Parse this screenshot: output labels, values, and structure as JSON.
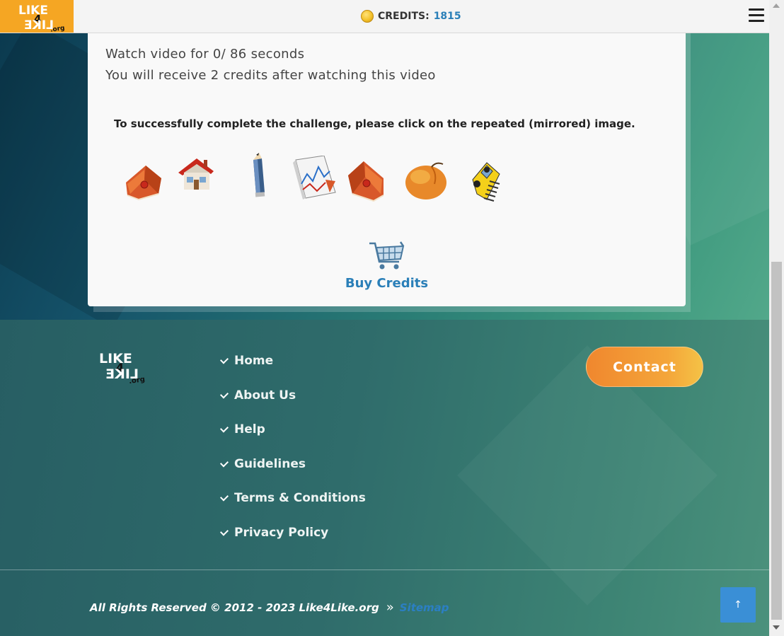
{
  "header": {
    "logo_text_top": "LIKE",
    "logo_text_num": "4",
    "logo_text_bottom": "LIKE",
    "logo_text_suffix": ".org",
    "credits_label": "CREDITS:",
    "credits_value": "1815",
    "coin_icon": "coin-icon",
    "menu_icon": "hamburger-menu-icon"
  },
  "card": {
    "watch_line": "Watch video for 0/ 86 seconds",
    "receive_line": "You will receive 2 credits after watching this video",
    "challenge_text": "To successfully complete the challenge, please click on the repeated (mirrored) image.",
    "captcha_images": [
      {
        "name": "book-icon"
      },
      {
        "name": "house-icon"
      },
      {
        "name": "pencil-icon"
      },
      {
        "name": "chart-icon"
      },
      {
        "name": "book-mirrored-icon"
      },
      {
        "name": "peach-icon"
      },
      {
        "name": "taxi-icon"
      }
    ],
    "buy_icon": "shopping-cart-icon",
    "buy_label": "Buy Credits"
  },
  "footer": {
    "nav": [
      "Home",
      "About Us",
      "Help",
      "Guidelines",
      "Terms & Conditions",
      "Privacy Policy"
    ],
    "contact_label": "Contact",
    "copyright": "All Rights Reserved © 2012 - 2023 Like4Like.org",
    "sitemap_label": "Sitemap",
    "chevron_glyph": "»",
    "to_top_glyph": "↑"
  },
  "colors": {
    "brand_orange": "#f5a623",
    "link_blue": "#2a7fb8",
    "contact_gradient_start": "#f0872e",
    "contact_gradient_end": "#f4c246",
    "to_top_blue": "#3a8fd6"
  }
}
